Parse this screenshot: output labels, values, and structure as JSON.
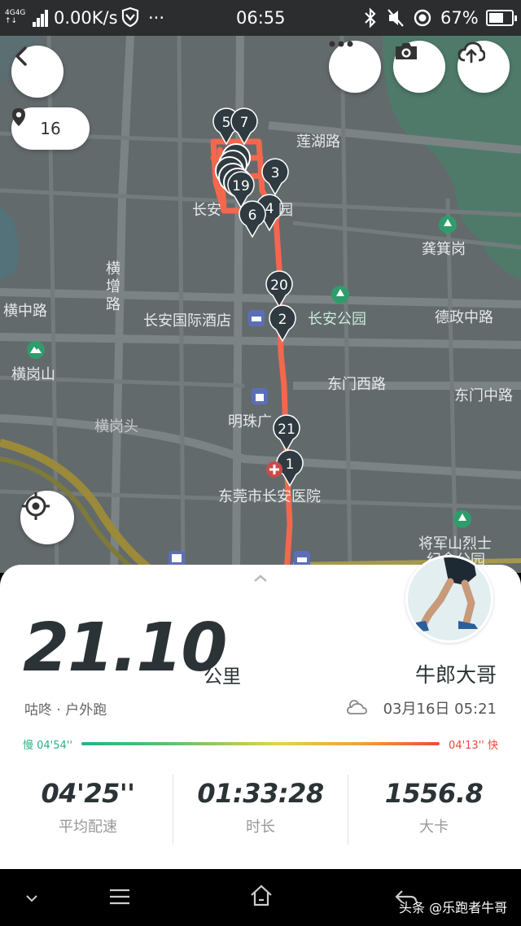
{
  "status_bar": {
    "network_label": "4G",
    "speed": "0.00K/s",
    "dots": "···",
    "time": "06:55",
    "battery_percent": "67%",
    "battery_level": 0.67
  },
  "map": {
    "location_count": "16",
    "labels": {
      "lianhu_road": "莲湖路",
      "changan": "长安",
      "yuan": "园",
      "hengzeng_road": "横\n增\n路",
      "hengzhong_road": "横中路",
      "changan_hotel": "长安国际酒店",
      "changan_park": "长安公园",
      "dezheng_road": "德政中路",
      "gongji_gang": "龚箕岗",
      "henggang_shan": "横岗山",
      "dongmen_west": "东门西路",
      "dongmen_mid": "东门中路",
      "henggang_tou": "横岗头",
      "mingzhu": "明珠广",
      "hospital": "东莞市长安医院",
      "martyrs": "将军山烈士",
      "martyrs2": "纪念公园"
    },
    "markers": [
      "5",
      "7",
      "3",
      "19",
      "4",
      "6",
      "20",
      "2",
      "21",
      "1"
    ]
  },
  "summary": {
    "distance": "21.10",
    "unit": "公里",
    "user_name": "牛郎大哥",
    "run_type": "咕咚 · 户外跑",
    "datetime": "03月16日 05:21",
    "slow_label": "慢 04'54''",
    "fast_label": "04'13'' 快",
    "stats": [
      {
        "value": "04'25''",
        "label": "平均配速"
      },
      {
        "value": "01:33:28",
        "label": "时长"
      },
      {
        "value": "1556.8",
        "label": "大卡"
      }
    ]
  },
  "watermark": "头条 @乐跑者牛哥",
  "colors": {
    "route": "#f3674d",
    "marker": "#2f3b41",
    "map_bg": "#636a6c",
    "text_dark": "#2b3336"
  }
}
